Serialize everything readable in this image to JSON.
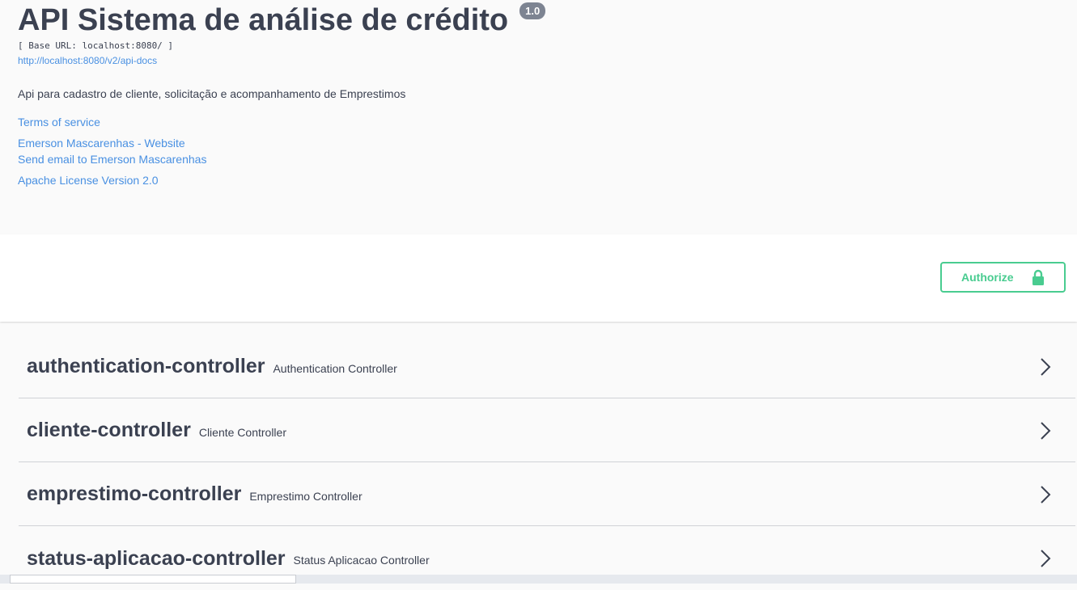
{
  "info": {
    "title": "API Sistema de análise de crédito",
    "version": "1.0",
    "base_url": "[ Base URL: localhost:8080/ ]",
    "docs_url": "http://localhost:8080/v2/api-docs",
    "description": "Api para cadastro de cliente, solicitação e acompanhamento de Emprestimos",
    "terms_of_service": "Terms of service",
    "contact_website": "Emerson Mascarenhas - Website",
    "contact_email": "Send email to Emerson Mascarenhas",
    "license": "Apache License Version 2.0"
  },
  "authorize": {
    "label": "Authorize",
    "icon": "lock-icon",
    "color": "#49cc90"
  },
  "tags": [
    {
      "name": "authentication-controller",
      "description": "Authentication Controller"
    },
    {
      "name": "cliente-controller",
      "description": "Cliente Controller"
    },
    {
      "name": "emprestimo-controller",
      "description": "Emprestimo Controller"
    },
    {
      "name": "status-aplicacao-controller",
      "description": "Status Aplicacao Controller"
    }
  ],
  "colors": {
    "link": "#4990e2",
    "text": "#3b4151",
    "version_badge": "#7d8492"
  }
}
